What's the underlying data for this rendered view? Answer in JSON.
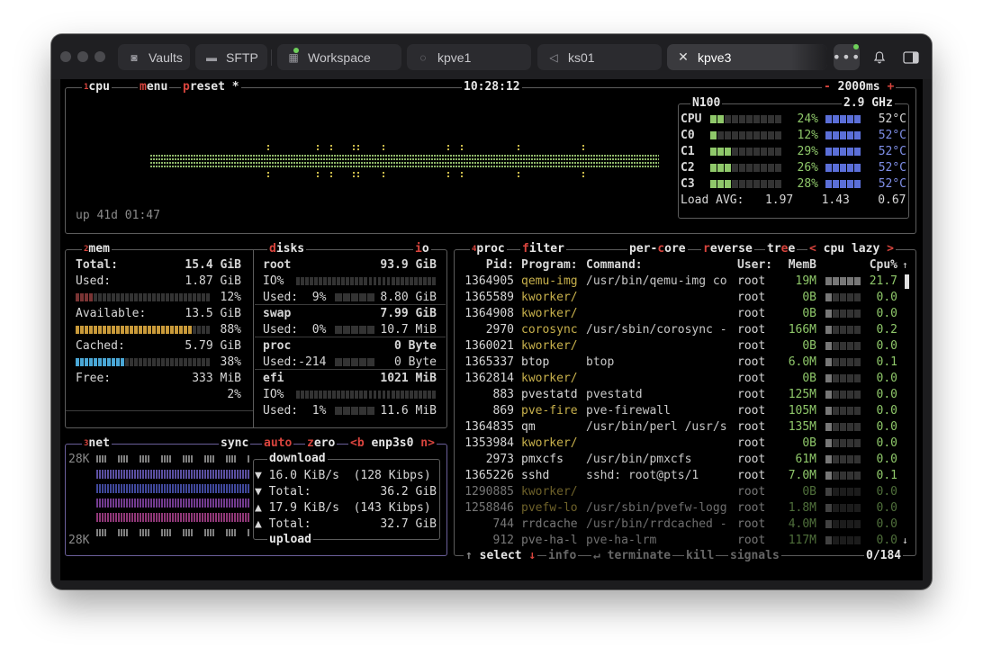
{
  "tabs": [
    {
      "label": "Vaults",
      "icon": "vault-icon"
    },
    {
      "label": "SFTP",
      "icon": "folder-icon"
    },
    {
      "label": "Workspace",
      "icon": "workspace-icon"
    },
    {
      "label": "kpve1",
      "icon": "terminal-icon"
    },
    {
      "label": "ks01",
      "icon": "terminal-icon"
    },
    {
      "label": "kpve3",
      "icon": "close-icon"
    }
  ],
  "cpu": {
    "box_num": "1",
    "title": "cpu",
    "menu": "menu",
    "preset": "preset *",
    "time": "10:28:12",
    "minus": "-",
    "interval": "2000ms",
    "plus": "+",
    "uptime": "up 41d 01:47",
    "model": "N100",
    "freq": "2.9 GHz",
    "rows": [
      {
        "label": "CPU",
        "pct": "24%",
        "temp": "52°C",
        "fill": 0.24
      },
      {
        "label": "C0",
        "pct": "12%",
        "temp": "52°C",
        "fill": 0.12
      },
      {
        "label": "C1",
        "pct": "29%",
        "temp": "52°C",
        "fill": 0.29
      },
      {
        "label": "C2",
        "pct": "26%",
        "temp": "52°C",
        "fill": 0.26
      },
      {
        "label": "C3",
        "pct": "28%",
        "temp": "52°C",
        "fill": 0.28
      }
    ],
    "load_label": "Load AVG:",
    "load": [
      "1.97",
      "1.43",
      "0.67"
    ]
  },
  "mem": {
    "box_num": "2",
    "title": "mem",
    "total_label": "Total:",
    "total": "15.4 GiB",
    "used_label": "Used:",
    "used": "1.87 GiB",
    "used_pct": "12%",
    "avail_label": "Available:",
    "avail": "13.5 GiB",
    "avail_pct": "88%",
    "cached_label": "Cached:",
    "cached": "5.79 GiB",
    "cached_pct": "38%",
    "free_label": "Free:",
    "free": "333 MiB",
    "free_pct": "2%"
  },
  "disks": {
    "title": "disks",
    "io": "io",
    "root_name": "root",
    "root_size": "93.9 GiB",
    "root_io": "IO%",
    "root_used": "Used:  9%",
    "root_used_v": "8.80 GiB",
    "swap_name": "swap",
    "swap_size": "7.99 GiB",
    "swap_used": "Used:  0%",
    "swap_used_v": "10.7 MiB",
    "proc_name": "proc",
    "proc_size": "0 Byte",
    "proc_used": "Used:-214",
    "proc_used_v": "0 Byte",
    "efi_name": "efi",
    "efi_size": "1021 MiB",
    "efi_io": "IO%",
    "efi_used": "Used:  1%",
    "efi_used_v": "11.6 MiB"
  },
  "net": {
    "box_num": "3",
    "title": "net",
    "sync": "sync",
    "auto": "auto",
    "zero": "zero",
    "prev": "<b",
    "iface": "enp3s0",
    "next": "n>",
    "top_scale": "28K",
    "bottom_scale": "28K",
    "download": "download",
    "dl_rate": "▼ 16.0 KiB/s  (128 Kibps)",
    "dl_total_label": "▼ Total:",
    "dl_total": "36.2 GiB",
    "ul_rate": "▲ 17.9 KiB/s  (143 Kibps)",
    "ul_total_label": "▲ Total:",
    "ul_total": "32.7 GiB",
    "upload": "upload"
  },
  "proc": {
    "box_num": "4",
    "title": "proc",
    "filter": "filter",
    "percore": "per-core",
    "reverse": "reverse",
    "tree": "tree",
    "sort_prev": "<",
    "sort": "cpu lazy",
    "sort_next": ">",
    "headers": {
      "pid": "Pid:",
      "program": "Program:",
      "command": "Command:",
      "user": "User:",
      "mem": "MemB",
      "cpu": "Cpu%"
    },
    "rows": [
      {
        "pid": "1364905",
        "program": "qemu-img",
        "command": "/usr/bin/qemu-img co",
        "user": "root",
        "mem": "19M",
        "cpu": "21.7"
      },
      {
        "pid": "1365589",
        "program": "kworker/",
        "command": "",
        "user": "root",
        "mem": "0B",
        "cpu": "0.0"
      },
      {
        "pid": "1364908",
        "program": "kworker/",
        "command": "",
        "user": "root",
        "mem": "0B",
        "cpu": "0.0"
      },
      {
        "pid": "2970",
        "program": "corosync",
        "command": "/usr/sbin/corosync -",
        "user": "root",
        "mem": "166M",
        "cpu": "0.2"
      },
      {
        "pid": "1360021",
        "program": "kworker/",
        "command": "",
        "user": "root",
        "mem": "0B",
        "cpu": "0.0"
      },
      {
        "pid": "1365337",
        "program": "btop",
        "command": "btop",
        "user": "root",
        "mem": "6.0M",
        "cpu": "0.1"
      },
      {
        "pid": "1362814",
        "program": "kworker/",
        "command": "",
        "user": "root",
        "mem": "0B",
        "cpu": "0.0"
      },
      {
        "pid": "883",
        "program": "pvestatd",
        "command": "pvestatd",
        "user": "root",
        "mem": "125M",
        "cpu": "0.0"
      },
      {
        "pid": "869",
        "program": "pve-fire",
        "command": "pve-firewall",
        "user": "root",
        "mem": "105M",
        "cpu": "0.0"
      },
      {
        "pid": "1364835",
        "program": "qm",
        "command": "/usr/bin/perl /usr/s",
        "user": "root",
        "mem": "135M",
        "cpu": "0.0"
      },
      {
        "pid": "1353984",
        "program": "kworker/",
        "command": "",
        "user": "root",
        "mem": "0B",
        "cpu": "0.0"
      },
      {
        "pid": "2973",
        "program": "pmxcfs",
        "command": "/usr/bin/pmxcfs",
        "user": "root",
        "mem": "61M",
        "cpu": "0.0"
      },
      {
        "pid": "1365226",
        "program": "sshd",
        "command": "sshd: root@pts/1",
        "user": "root",
        "mem": "7.0M",
        "cpu": "0.1"
      },
      {
        "pid": "1290885",
        "program": "kworker/",
        "command": "",
        "user": "root",
        "mem": "0B",
        "cpu": "0.0"
      },
      {
        "pid": "1258846",
        "program": "pvefw-lo",
        "command": "/usr/sbin/pvefw-logg",
        "user": "root",
        "mem": "1.8M",
        "cpu": "0.0"
      },
      {
        "pid": "744",
        "program": "rrdcache",
        "command": "/usr/bin/rrdcached -",
        "user": "root",
        "mem": "4.0M",
        "cpu": "0.0"
      },
      {
        "pid": "912",
        "program": "pve-ha-l",
        "command": "pve-ha-lrm",
        "user": "root",
        "mem": "117M",
        "cpu": "0.0"
      }
    ],
    "footer": {
      "select": "select",
      "info": "info",
      "terminate": "terminate",
      "kill": "kill",
      "signals": "signals",
      "count": "0/184"
    }
  },
  "colors": {
    "accent_red": "#d8443d",
    "green": "#8fc86a",
    "blue": "#5b6fd8",
    "pink": "#d25aa8"
  }
}
